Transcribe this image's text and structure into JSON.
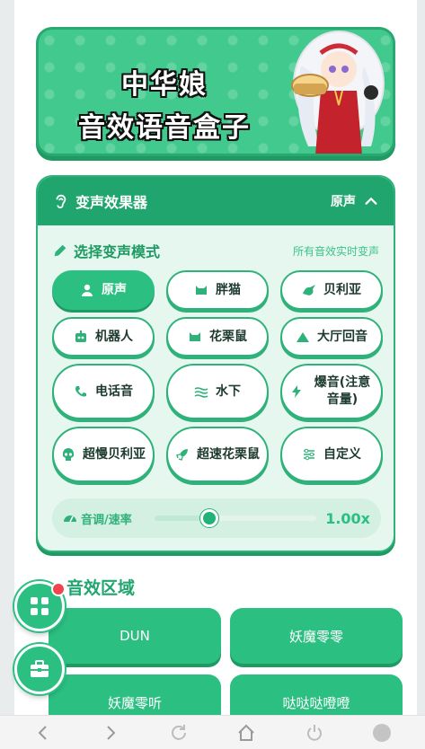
{
  "banner": {
    "line1": "中华娘",
    "line2": "音效语音盒子"
  },
  "effects": {
    "header_title": "变声效果器",
    "current_mode": "原声",
    "mode_title": "选择变声模式",
    "mode_note": "所有音效实时变声",
    "buttons": [
      {
        "label": "原声",
        "icon": "person-icon",
        "active": true
      },
      {
        "label": "胖猫",
        "icon": "cat-icon"
      },
      {
        "label": "贝利亚",
        "icon": "dragon-icon"
      },
      {
        "label": "机器人",
        "icon": "robot-icon"
      },
      {
        "label": "花栗鼠",
        "icon": "cat-icon"
      },
      {
        "label": "大厅回音",
        "icon": "mountain-icon"
      },
      {
        "label": "电话音",
        "icon": "phone-icon"
      },
      {
        "label": "水下",
        "icon": "water-icon"
      },
      {
        "label": "爆音(注意音量)",
        "icon": "bolt-icon"
      },
      {
        "label": "超慢贝利亚",
        "icon": "skull-icon"
      },
      {
        "label": "超速花栗鼠",
        "icon": "rocket-icon"
      },
      {
        "label": "自定义",
        "icon": "sliders-icon"
      }
    ],
    "pitch_label": "音调/速率",
    "pitch_value": "1.00x",
    "pitch_level": 0.34
  },
  "sfx": {
    "title": "音效区域",
    "items": [
      "DUN",
      "妖魔零零",
      "妖魔零听",
      "哒哒哒噔噔"
    ]
  },
  "colors": {
    "brand": "#2cbf82",
    "brand_dark": "#1f9a63",
    "badge": "#f0454e"
  }
}
